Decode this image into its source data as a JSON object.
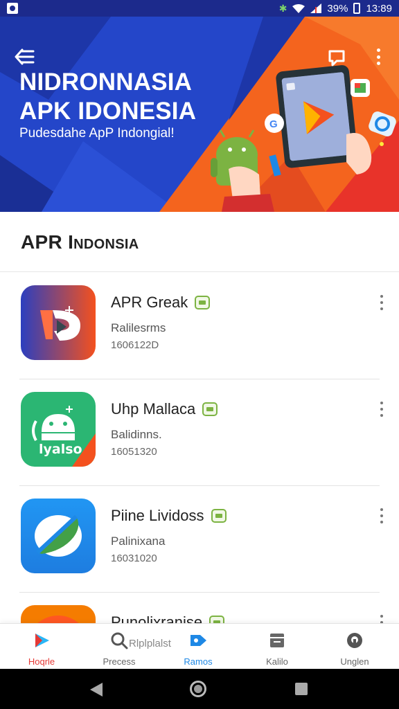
{
  "status_bar": {
    "battery": "39%",
    "time": "13:89"
  },
  "hero": {
    "title": "NIDRONNASIA APK IDONESIA",
    "subtitle": "Pudesdahe ApP Indongial!",
    "colors": {
      "blue": "#2446c9",
      "orange": "#f4641e",
      "red": "#e8332a"
    }
  },
  "section": {
    "title": "APR Indonsia"
  },
  "apps": [
    {
      "name": "APR Greak",
      "category": "Ralilesrms",
      "size": "1606122D"
    },
    {
      "name": "Uhp Mallaca",
      "category": "Balidinns.",
      "size": "16051320"
    },
    {
      "name": "Piine Lividoss",
      "category": "Palinixana",
      "size": "16031020"
    },
    {
      "name": "Punolixranise",
      "category": "",
      "size": ""
    }
  ],
  "app_icon_tiles": {
    "tile2_text": "lyalso"
  },
  "bottom_nav": {
    "items": [
      {
        "label": "Hoqrle",
        "icon": "play-store-icon"
      },
      {
        "label": "Precess",
        "icon": "search-icon"
      },
      {
        "label": "Ramos",
        "icon": "tag-icon"
      },
      {
        "label": "Kalilo",
        "icon": "archive-icon"
      },
      {
        "label": "Unglen",
        "icon": "settings-icon"
      }
    ],
    "search_extra": "Rlplplalst"
  }
}
